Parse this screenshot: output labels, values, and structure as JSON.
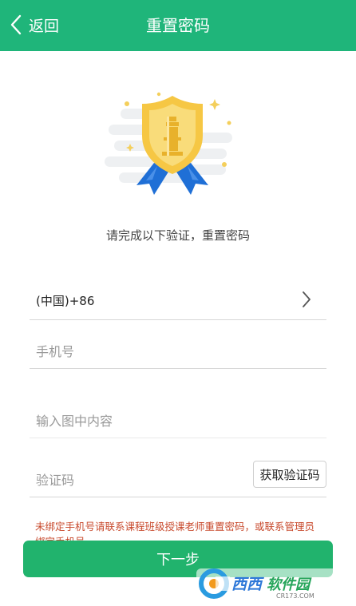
{
  "header": {
    "back_label": "返回",
    "title": "重置密码"
  },
  "main": {
    "subtitle": "请完成以下验证，重置密码",
    "country_code": "(中国)+86",
    "phone_placeholder": "手机号",
    "captcha_placeholder": "输入图中内容",
    "code_placeholder": "验证码",
    "get_code_label": "获取验证码",
    "notice": "未绑定手机号请联系课程班级授课老师重置密码，或联系管理员绑定手机号",
    "next_label": "下一步"
  },
  "watermark": {
    "brand": "西西软件园",
    "domain": "CR173.COM"
  },
  "colors": {
    "brand_green": "#1fb57a",
    "button_green": "#21b36d",
    "notice_red": "#c8492c",
    "badge_gold": "#f6c744",
    "ribbon_blue": "#1f6fd6"
  }
}
